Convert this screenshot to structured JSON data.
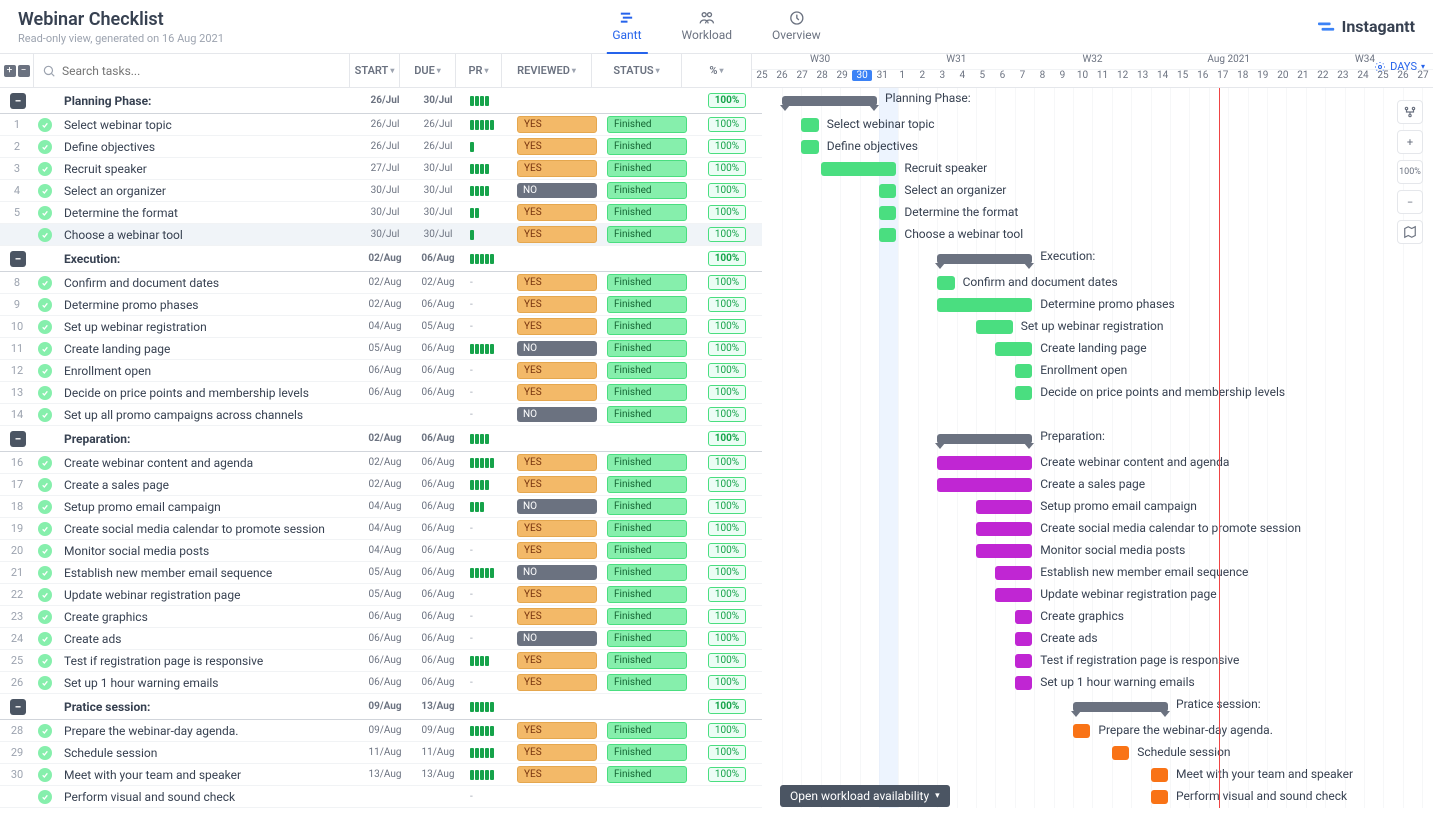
{
  "app": {
    "title": "Webinar Checklist",
    "subtitle": "Read-only view, generated on 16 Aug 2021",
    "brand": "Instagantt"
  },
  "tabs": [
    {
      "id": "gantt",
      "label": "Gantt",
      "active": true
    },
    {
      "id": "workload",
      "label": "Workload",
      "active": false
    },
    {
      "id": "overview",
      "label": "Overview",
      "active": false
    }
  ],
  "search": {
    "placeholder": "Search tasks..."
  },
  "columns": {
    "start": "START",
    "due": "DUE",
    "pr": "PR",
    "reviewed": "REVIEWED",
    "status": "STATUS",
    "pct": "%"
  },
  "days_btn": "DAYS",
  "timeline": {
    "weeks": [
      "W30",
      "W31",
      "W32",
      "",
      "W34"
    ],
    "month": "Aug 2021",
    "days": [
      25,
      26,
      27,
      28,
      29,
      30,
      31,
      1,
      2,
      3,
      4,
      5,
      6,
      7,
      8,
      9,
      10,
      11,
      12,
      13,
      14,
      15,
      16,
      17,
      18,
      19,
      20,
      21,
      22,
      23,
      24,
      25,
      26,
      27
    ],
    "selected_day_index": 5,
    "today_day_index": 22,
    "day_width": 19.4
  },
  "zoom_label": "100%",
  "footer": "Open workload availability",
  "rows": [
    {
      "type": "group",
      "name": "Planning Phase:",
      "start": "26/Jul",
      "due": "30/Jul",
      "pr": 4,
      "pct": "100%",
      "bar_start": 0,
      "bar_len": 5,
      "color": "grp"
    },
    {
      "n": 1,
      "name": "Select webinar topic",
      "start": "26/Jul",
      "due": "26/Jul",
      "pr": 5,
      "rev": "YES",
      "status": "Finished",
      "pct": "100%",
      "bar_start": 1,
      "bar_len": 1,
      "color": "green"
    },
    {
      "n": 2,
      "name": "Define objectives",
      "start": "26/Jul",
      "due": "26/Jul",
      "pr": 1,
      "rev": "YES",
      "status": "Finished",
      "pct": "100%",
      "bar_start": 1,
      "bar_len": 1,
      "color": "green"
    },
    {
      "n": 3,
      "name": "Recruit speaker",
      "start": "27/Jul",
      "due": "30/Jul",
      "pr": 4,
      "rev": "YES",
      "status": "Finished",
      "pct": "100%",
      "bar_start": 2,
      "bar_len": 4,
      "color": "green"
    },
    {
      "n": 4,
      "name": "Select an organizer",
      "start": "30/Jul",
      "due": "30/Jul",
      "pr": 4,
      "rev": "NO",
      "status": "Finished",
      "pct": "100%",
      "bar_start": 5,
      "bar_len": 1,
      "color": "green"
    },
    {
      "n": 5,
      "name": "Determine the format",
      "start": "30/Jul",
      "due": "30/Jul",
      "pr": 2,
      "rev": "YES",
      "status": "Finished",
      "pct": "100%",
      "bar_start": 5,
      "bar_len": 1,
      "color": "green"
    },
    {
      "n": "",
      "name": "Choose a webinar tool",
      "start": "30/Jul",
      "due": "30/Jul",
      "pr": 1,
      "rev": "YES",
      "status": "Finished",
      "pct": "100%",
      "bar_start": 5,
      "bar_len": 1,
      "color": "green",
      "highlight": true
    },
    {
      "type": "group",
      "name": "Execution:",
      "start": "02/Aug",
      "due": "06/Aug",
      "pr": 5,
      "pct": "100%",
      "bar_start": 8,
      "bar_len": 5,
      "color": "grp"
    },
    {
      "n": 8,
      "name": "Confirm and document dates",
      "start": "02/Aug",
      "due": "02/Aug",
      "pr": 0,
      "rev": "YES",
      "status": "Finished",
      "pct": "100%",
      "bar_start": 8,
      "bar_len": 1,
      "color": "green"
    },
    {
      "n": 9,
      "name": "Determine promo phases",
      "start": "02/Aug",
      "due": "06/Aug",
      "pr": 0,
      "rev": "YES",
      "status": "Finished",
      "pct": "100%",
      "bar_start": 8,
      "bar_len": 5,
      "color": "green"
    },
    {
      "n": 10,
      "name": "Set up webinar registration",
      "start": "04/Aug",
      "due": "05/Aug",
      "pr": 0,
      "rev": "YES",
      "status": "Finished",
      "pct": "100%",
      "bar_start": 10,
      "bar_len": 2,
      "color": "green"
    },
    {
      "n": 11,
      "name": "Create landing page",
      "start": "05/Aug",
      "due": "06/Aug",
      "pr": 5,
      "rev": "NO",
      "status": "Finished",
      "pct": "100%",
      "bar_start": 11,
      "bar_len": 2,
      "color": "green"
    },
    {
      "n": 12,
      "name": "Enrollment open",
      "start": "06/Aug",
      "due": "06/Aug",
      "pr": 0,
      "rev": "YES",
      "status": "Finished",
      "pct": "100%",
      "bar_start": 12,
      "bar_len": 1,
      "color": "green"
    },
    {
      "n": 13,
      "name": "Decide on price points and membership levels",
      "start": "06/Aug",
      "due": "06/Aug",
      "pr": 0,
      "rev": "YES",
      "status": "Finished",
      "pct": "100%",
      "bar_start": 12,
      "bar_len": 1,
      "color": "green"
    },
    {
      "n": 14,
      "name": "Set up all promo campaigns across channels",
      "start": "",
      "due": "",
      "pr": 0,
      "rev": "NO",
      "status": "Finished",
      "pct": "100%",
      "bar_start": null,
      "bar_len": 0,
      "color": "green"
    },
    {
      "type": "group",
      "name": "Preparation:",
      "start": "02/Aug",
      "due": "06/Aug",
      "pr": 4,
      "pct": "100%",
      "bar_start": 8,
      "bar_len": 5,
      "color": "grp"
    },
    {
      "n": 16,
      "name": "Create webinar content and agenda",
      "start": "02/Aug",
      "due": "06/Aug",
      "pr": 5,
      "rev": "YES",
      "status": "Finished",
      "pct": "100%",
      "bar_start": 8,
      "bar_len": 5,
      "color": "pink"
    },
    {
      "n": 17,
      "name": "Create a sales page",
      "start": "02/Aug",
      "due": "06/Aug",
      "pr": 4,
      "rev": "YES",
      "status": "Finished",
      "pct": "100%",
      "bar_start": 8,
      "bar_len": 5,
      "color": "pink"
    },
    {
      "n": 18,
      "name": "Setup promo email campaign",
      "start": "04/Aug",
      "due": "06/Aug",
      "pr": 3,
      "rev": "NO",
      "status": "Finished",
      "pct": "100%",
      "bar_start": 10,
      "bar_len": 3,
      "color": "pink"
    },
    {
      "n": 19,
      "name": "Create social media calendar to promote session",
      "start": "04/Aug",
      "due": "06/Aug",
      "pr": 0,
      "rev": "YES",
      "status": "Finished",
      "pct": "100%",
      "bar_start": 10,
      "bar_len": 3,
      "color": "pink"
    },
    {
      "n": 20,
      "name": "Monitor social media posts",
      "start": "04/Aug",
      "due": "06/Aug",
      "pr": 0,
      "rev": "YES",
      "status": "Finished",
      "pct": "100%",
      "bar_start": 10,
      "bar_len": 3,
      "color": "pink"
    },
    {
      "n": 21,
      "name": "Establish new member email sequence",
      "start": "05/Aug",
      "due": "06/Aug",
      "pr": 5,
      "rev": "NO",
      "status": "Finished",
      "pct": "100%",
      "bar_start": 11,
      "bar_len": 2,
      "color": "pink"
    },
    {
      "n": 22,
      "name": "Update webinar registration page",
      "start": "05/Aug",
      "due": "06/Aug",
      "pr": 0,
      "rev": "YES",
      "status": "Finished",
      "pct": "100%",
      "bar_start": 11,
      "bar_len": 2,
      "color": "pink"
    },
    {
      "n": 23,
      "name": "Create graphics",
      "start": "06/Aug",
      "due": "06/Aug",
      "pr": 0,
      "rev": "YES",
      "status": "Finished",
      "pct": "100%",
      "bar_start": 12,
      "bar_len": 1,
      "color": "pink"
    },
    {
      "n": 24,
      "name": "Create ads",
      "start": "06/Aug",
      "due": "06/Aug",
      "pr": 0,
      "rev": "NO",
      "status": "Finished",
      "pct": "100%",
      "bar_start": 12,
      "bar_len": 1,
      "color": "pink"
    },
    {
      "n": 25,
      "name": "Test if registration page is responsive",
      "start": "06/Aug",
      "due": "06/Aug",
      "pr": 4,
      "rev": "YES",
      "status": "Finished",
      "pct": "100%",
      "bar_start": 12,
      "bar_len": 1,
      "color": "pink"
    },
    {
      "n": 26,
      "name": "Set up 1 hour warning emails",
      "start": "06/Aug",
      "due": "06/Aug",
      "pr": 0,
      "rev": "YES",
      "status": "Finished",
      "pct": "100%",
      "bar_start": 12,
      "bar_len": 1,
      "color": "pink"
    },
    {
      "type": "group",
      "name": "Pratice session:",
      "start": "09/Aug",
      "due": "13/Aug",
      "pr": 5,
      "pct": "100%",
      "bar_start": 15,
      "bar_len": 5,
      "color": "grp"
    },
    {
      "n": 28,
      "name": "Prepare the webinar-day agenda.",
      "start": "09/Aug",
      "due": "09/Aug",
      "pr": 5,
      "rev": "YES",
      "status": "Finished",
      "pct": "100%",
      "bar_start": 15,
      "bar_len": 1,
      "color": "orange"
    },
    {
      "n": 29,
      "name": "Schedule session",
      "start": "11/Aug",
      "due": "11/Aug",
      "pr": 5,
      "rev": "YES",
      "status": "Finished",
      "pct": "100%",
      "bar_start": 17,
      "bar_len": 1,
      "color": "orange"
    },
    {
      "n": 30,
      "name": "Meet with your team and speaker",
      "start": "13/Aug",
      "due": "13/Aug",
      "pr": 5,
      "rev": "YES",
      "status": "Finished",
      "pct": "100%",
      "bar_start": 19,
      "bar_len": 1,
      "color": "orange"
    },
    {
      "n": "",
      "name": "Perform visual and sound check",
      "start": "",
      "due": "",
      "pr": 0,
      "rev": "",
      "status": "",
      "pct": "",
      "bar_start": 19,
      "bar_len": 1,
      "color": "orange",
      "partial": true
    }
  ]
}
